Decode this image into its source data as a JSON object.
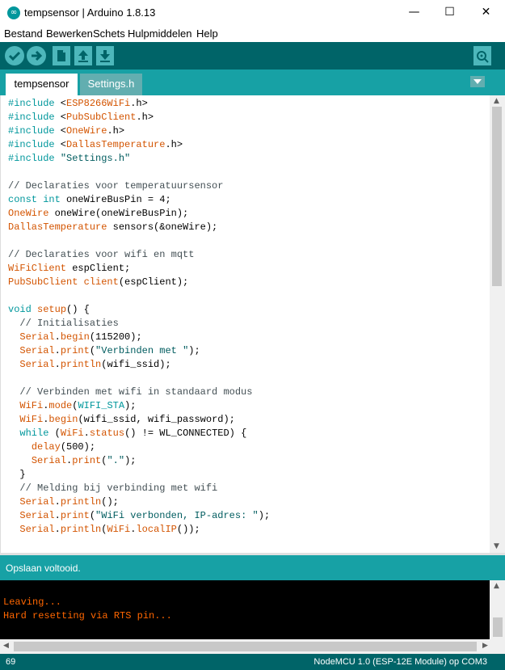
{
  "window": {
    "title": "tempsensor | Arduino 1.8.13",
    "app_icon": "∞",
    "controls": {
      "minimize": "—",
      "maximize": "☐",
      "close": "✕"
    }
  },
  "menu": [
    "Bestand",
    "Bewerken",
    "Schets",
    "Hulpmiddelen",
    "Help"
  ],
  "toolbar": {
    "buttons": [
      "verify-icon",
      "upload-icon",
      "new-icon",
      "open-icon",
      "save-icon"
    ],
    "serial_monitor": "serial-monitor-icon",
    "glyphs": {
      "verify": "✓",
      "upload": "➜",
      "new": "▯",
      "open": "⇧",
      "save": "⇩",
      "serial": "⌕"
    }
  },
  "tabs": [
    {
      "label": "tempsensor",
      "active": true
    },
    {
      "label": "Settings.h",
      "active": false
    }
  ],
  "tab_menu_glyph": "▼",
  "code_lines": [
    [
      [
        "kw",
        "#include"
      ],
      [
        "",
        " <"
      ],
      [
        "typ",
        "ESP8266WiFi"
      ],
      [
        "",
        ".h>"
      ]
    ],
    [
      [
        "kw",
        "#include"
      ],
      [
        "",
        " <"
      ],
      [
        "typ",
        "PubSubClient"
      ],
      [
        "",
        ".h>"
      ]
    ],
    [
      [
        "kw",
        "#include"
      ],
      [
        "",
        " <"
      ],
      [
        "typ",
        "OneWire"
      ],
      [
        "",
        ".h>"
      ]
    ],
    [
      [
        "kw",
        "#include"
      ],
      [
        "",
        " <"
      ],
      [
        "typ",
        "DallasTemperature"
      ],
      [
        "",
        ".h>"
      ]
    ],
    [
      [
        "kw",
        "#include"
      ],
      [
        "",
        " "
      ],
      [
        "str",
        "\"Settings.h\""
      ]
    ],
    [],
    [
      [
        "cmt",
        "// Declaraties voor temperatuursensor"
      ]
    ],
    [
      [
        "kw",
        "const"
      ],
      [
        "",
        " "
      ],
      [
        "kw",
        "int"
      ],
      [
        "",
        " oneWireBusPin = 4;"
      ]
    ],
    [
      [
        "typ",
        "OneWire"
      ],
      [
        "",
        " oneWire(oneWireBusPin);"
      ]
    ],
    [
      [
        "typ",
        "DallasTemperature"
      ],
      [
        "",
        " sensors(&oneWire);"
      ]
    ],
    [],
    [
      [
        "cmt",
        "// Declaraties voor wifi en mqtt"
      ]
    ],
    [
      [
        "typ",
        "WiFiClient"
      ],
      [
        "",
        " espClient;"
      ]
    ],
    [
      [
        "typ",
        "PubSubClient"
      ],
      [
        "",
        " "
      ],
      [
        "fn",
        "client"
      ],
      [
        "",
        "(espClient);"
      ]
    ],
    [],
    [
      [
        "kw",
        "void"
      ],
      [
        "",
        " "
      ],
      [
        "fn",
        "setup"
      ],
      [
        "",
        "() {"
      ]
    ],
    [
      [
        "",
        "  "
      ],
      [
        "cmt",
        "// Initialisaties"
      ]
    ],
    [
      [
        "",
        "  "
      ],
      [
        "typ",
        "Serial"
      ],
      [
        "",
        "."
      ],
      [
        "fn",
        "begin"
      ],
      [
        "",
        "(115200);"
      ]
    ],
    [
      [
        "",
        "  "
      ],
      [
        "typ",
        "Serial"
      ],
      [
        "",
        "."
      ],
      [
        "fn",
        "print"
      ],
      [
        "",
        "("
      ],
      [
        "str",
        "\"Verbinden met \""
      ],
      [
        "",
        ");"
      ]
    ],
    [
      [
        "",
        "  "
      ],
      [
        "typ",
        "Serial"
      ],
      [
        "",
        "."
      ],
      [
        "fn",
        "println"
      ],
      [
        "",
        "(wifi_ssid);"
      ]
    ],
    [],
    [
      [
        "",
        "  "
      ],
      [
        "cmt",
        "// Verbinden met wifi in standaard modus"
      ]
    ],
    [
      [
        "",
        "  "
      ],
      [
        "typ",
        "WiFi"
      ],
      [
        "",
        "."
      ],
      [
        "fn",
        "mode"
      ],
      [
        "",
        "("
      ],
      [
        "kw",
        "WIFI_STA"
      ],
      [
        "",
        ");"
      ]
    ],
    [
      [
        "",
        "  "
      ],
      [
        "typ",
        "WiFi"
      ],
      [
        "",
        "."
      ],
      [
        "fn",
        "begin"
      ],
      [
        "",
        "(wifi_ssid, wifi_password);"
      ]
    ],
    [
      [
        "",
        "  "
      ],
      [
        "kw",
        "while"
      ],
      [
        "",
        " ("
      ],
      [
        "typ",
        "WiFi"
      ],
      [
        "",
        "."
      ],
      [
        "fn",
        "status"
      ],
      [
        "",
        "() != WL_CONNECTED) {"
      ]
    ],
    [
      [
        "",
        "    "
      ],
      [
        "fn",
        "delay"
      ],
      [
        "",
        "(500);"
      ]
    ],
    [
      [
        "",
        "    "
      ],
      [
        "typ",
        "Serial"
      ],
      [
        "",
        "."
      ],
      [
        "fn",
        "print"
      ],
      [
        "",
        "("
      ],
      [
        "str",
        "\".\""
      ],
      [
        "",
        ");"
      ]
    ],
    [
      [
        "",
        "  }"
      ]
    ],
    [
      [
        "",
        "  "
      ],
      [
        "cmt",
        "// Melding bij verbinding met wifi"
      ]
    ],
    [
      [
        "",
        "  "
      ],
      [
        "typ",
        "Serial"
      ],
      [
        "",
        "."
      ],
      [
        "fn",
        "println"
      ],
      [
        "",
        "();"
      ]
    ],
    [
      [
        "",
        "  "
      ],
      [
        "typ",
        "Serial"
      ],
      [
        "",
        "."
      ],
      [
        "fn",
        "print"
      ],
      [
        "",
        "("
      ],
      [
        "str",
        "\"WiFi verbonden, IP-adres: \""
      ],
      [
        "",
        ");"
      ]
    ],
    [
      [
        "",
        "  "
      ],
      [
        "typ",
        "Serial"
      ],
      [
        "",
        "."
      ],
      [
        "fn",
        "println"
      ],
      [
        "",
        "("
      ],
      [
        "typ",
        "WiFi"
      ],
      [
        "",
        "."
      ],
      [
        "fn",
        "localIP"
      ],
      [
        "",
        "());"
      ]
    ]
  ],
  "status": {
    "message": "Opslaan voltooid."
  },
  "console": {
    "lines": [
      "",
      "Leaving...",
      "Hard resetting via RTS pin..."
    ]
  },
  "scroll_glyphs": {
    "up": "▲",
    "down": "▼",
    "left": "◀",
    "right": "▶"
  },
  "footer": {
    "line_number": "69",
    "board": "NodeMCU 1.0 (ESP-12E Module) op COM3"
  },
  "colors": {
    "toolbar": "#006468",
    "tabbar": "#17a1a5",
    "keyword": "#00979c",
    "type": "#d35400",
    "console_text": "#ff6600"
  }
}
